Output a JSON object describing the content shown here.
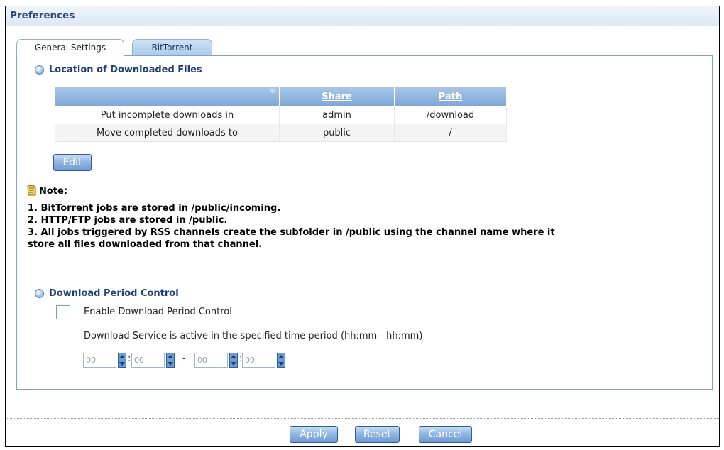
{
  "header": {
    "title": "Preferences"
  },
  "tabs": [
    {
      "label": "General Settings",
      "active": true
    },
    {
      "label": "BitTorrent",
      "active": false
    }
  ],
  "location": {
    "title": "Location of Downloaded Files",
    "columns": [
      "Share",
      "Path"
    ],
    "rows": [
      {
        "label": "Put incomplete downloads in",
        "share": "admin",
        "path": "/download"
      },
      {
        "label": "Move completed downloads to",
        "share": "public",
        "path": "/"
      }
    ],
    "edit_label": "Edit"
  },
  "note": {
    "title": "Note:",
    "lines": [
      "1. BitTorrent jobs are stored in /public/incoming.",
      "2. HTTP/FTP jobs are stored in /public.",
      "3. All jobs triggered by RSS channels create the subfolder in /public using the channel name where it",
      "store all files downloaded from that channel."
    ]
  },
  "period": {
    "title": "Download Period Control",
    "enable_label": "Enable Download Period Control",
    "enabled": false,
    "description": "Download Service is active in the specified time period (hh:mm - hh:mm)",
    "start_hour": "00",
    "start_minute": "00",
    "end_hour": "00",
    "end_minute": "00",
    "colon": ":",
    "dash": "-"
  },
  "footer": {
    "apply_label": "Apply",
    "reset_label": "Reset",
    "cancel_label": "Cancel"
  },
  "colors": {
    "accent": "#1f3f78",
    "header_bg": "#dde8f3",
    "button": "#8eb3e0"
  }
}
